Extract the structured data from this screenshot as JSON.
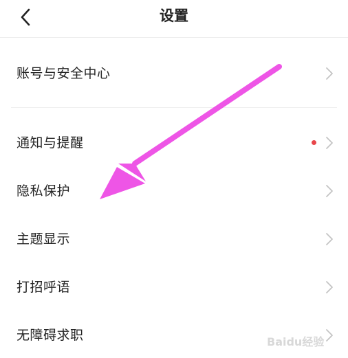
{
  "header": {
    "title": "设置"
  },
  "sections": [
    {
      "items": [
        {
          "label": "账号与安全中心"
        }
      ]
    },
    {
      "items": [
        {
          "label": "通知与提醒",
          "badge": "red-dot"
        },
        {
          "label": "隐私保护"
        },
        {
          "label": "主题显示"
        },
        {
          "label": "打招呼语"
        },
        {
          "label": "无障碍求职"
        }
      ]
    }
  ],
  "colors": {
    "badge": "#e8464a",
    "annotation_arrow": "#ee55e6",
    "chevron": "#c4c4c4"
  },
  "watermark": {
    "text": "Baidu经验"
  }
}
